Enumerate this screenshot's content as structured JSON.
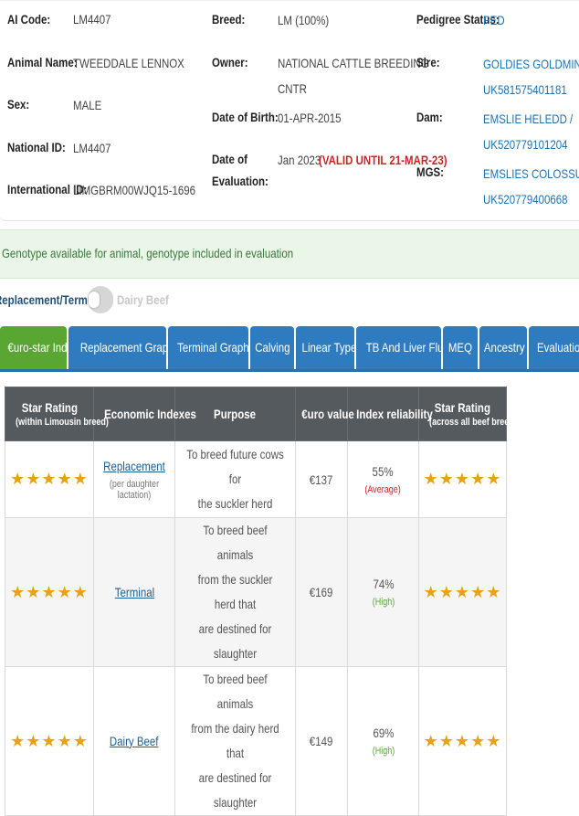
{
  "animal": {
    "ai_code_label": "AI Code:",
    "ai_code": "LM4407",
    "name_label": "Animal Name:",
    "name": "TWEEDDALE LENNOX",
    "sex_label": "Sex:",
    "sex": "MALE",
    "national_id_label": "National ID:",
    "national_id": "LM4407",
    "international_id_label": "International ID:",
    "international_id": "LIMGBRM00WJQ15-1696",
    "breed_label": "Breed:",
    "breed": "LM (100%)",
    "owner_label": "Owner:",
    "owner_line1": "NATIONAL CATTLE BREEDING",
    "owner_line2": "CNTR",
    "dob_label": "Date of Birth:",
    "dob": "01-APR-2015",
    "eval_label_line1": "Date of",
    "eval_label_line2": "Evaluation:",
    "eval_date": "Jan 2023",
    "eval_valid": "(VALID UNTIL 21-MAR-23)",
    "pedigree_label": "Pedigree Status:",
    "pedigree": "PED",
    "sire_label": "Sire:",
    "sire_line1": "GOLDIES GOLDMINE /",
    "sire_line2": "UK581575401181",
    "dam_label": "Dam:",
    "dam_line1": "EMSLIE HELEDD /",
    "dam_line2": "UK520779101204",
    "mgs_label": "MGS:",
    "mgs_line1": "EMSLIES COLOSSUS /",
    "mgs_line2": "UK520779400668"
  },
  "genotype_notice": "Genotype available for animal, genotype included in evaluation",
  "toggle": {
    "left_label": "Replacement/Terminal",
    "right_label": "Dairy Beef"
  },
  "tabs": [
    {
      "label": "€uro-star Index"
    },
    {
      "label": "Replacement Graphics"
    },
    {
      "label": "Terminal Graphics"
    },
    {
      "label": "Calving"
    },
    {
      "label": "Linear Type"
    },
    {
      "label": "TB And Liver Fluke"
    },
    {
      "label": "MEQ"
    },
    {
      "label": "Ancestry"
    },
    {
      "label": "Evaluation History"
    }
  ],
  "table": {
    "headers": {
      "star_rating_within": "Star Rating",
      "star_rating_within_sub": "(within Limousin breed)",
      "economic_indexes": "Economic Indexes",
      "purpose": "Purpose",
      "euro_value": "€uro value",
      "index_reliability": "Index reliability",
      "star_rating_across": "Star Rating",
      "star_rating_across_sub": "(across all beef breeds)"
    },
    "rows": [
      {
        "stars_within": "★★★★★",
        "index": "Replacement",
        "index_sub": "(per daughter lactation)",
        "purpose_1": "To breed future cows for",
        "purpose_2": "the suckler herd",
        "purpose_3": "",
        "value": "€137",
        "reliability": "55%",
        "reliability_level": "(Average)",
        "stars_across": "★★★★★"
      },
      {
        "stars_within": "★★★★★",
        "index": "Terminal",
        "index_sub": "",
        "purpose_1": "To breed beef animals",
        "purpose_2": "from the suckler herd that",
        "purpose_3": "are destined for slaughter",
        "value": "€169",
        "reliability": "74%",
        "reliability_level": "(High)",
        "stars_across": "★★★★★"
      },
      {
        "stars_within": "★★★★★",
        "index": "Dairy Beef",
        "index_sub": "",
        "purpose_1": "To breed beef animals",
        "purpose_2": "from the dairy herd that",
        "purpose_3": "are destined for slaughter",
        "value": "€149",
        "reliability": "69%",
        "reliability_level": "(High)",
        "stars_across": "★★★★★"
      }
    ]
  },
  "colors": {
    "link": "#1a73b8",
    "active_tab": "#5aa633",
    "tab": "#2e7bbf",
    "star": "#e8a21a",
    "average": "#c62828",
    "high": "#5aa633",
    "notice_bg": "#eaf6e8",
    "notice_text": "#3c763d"
  }
}
